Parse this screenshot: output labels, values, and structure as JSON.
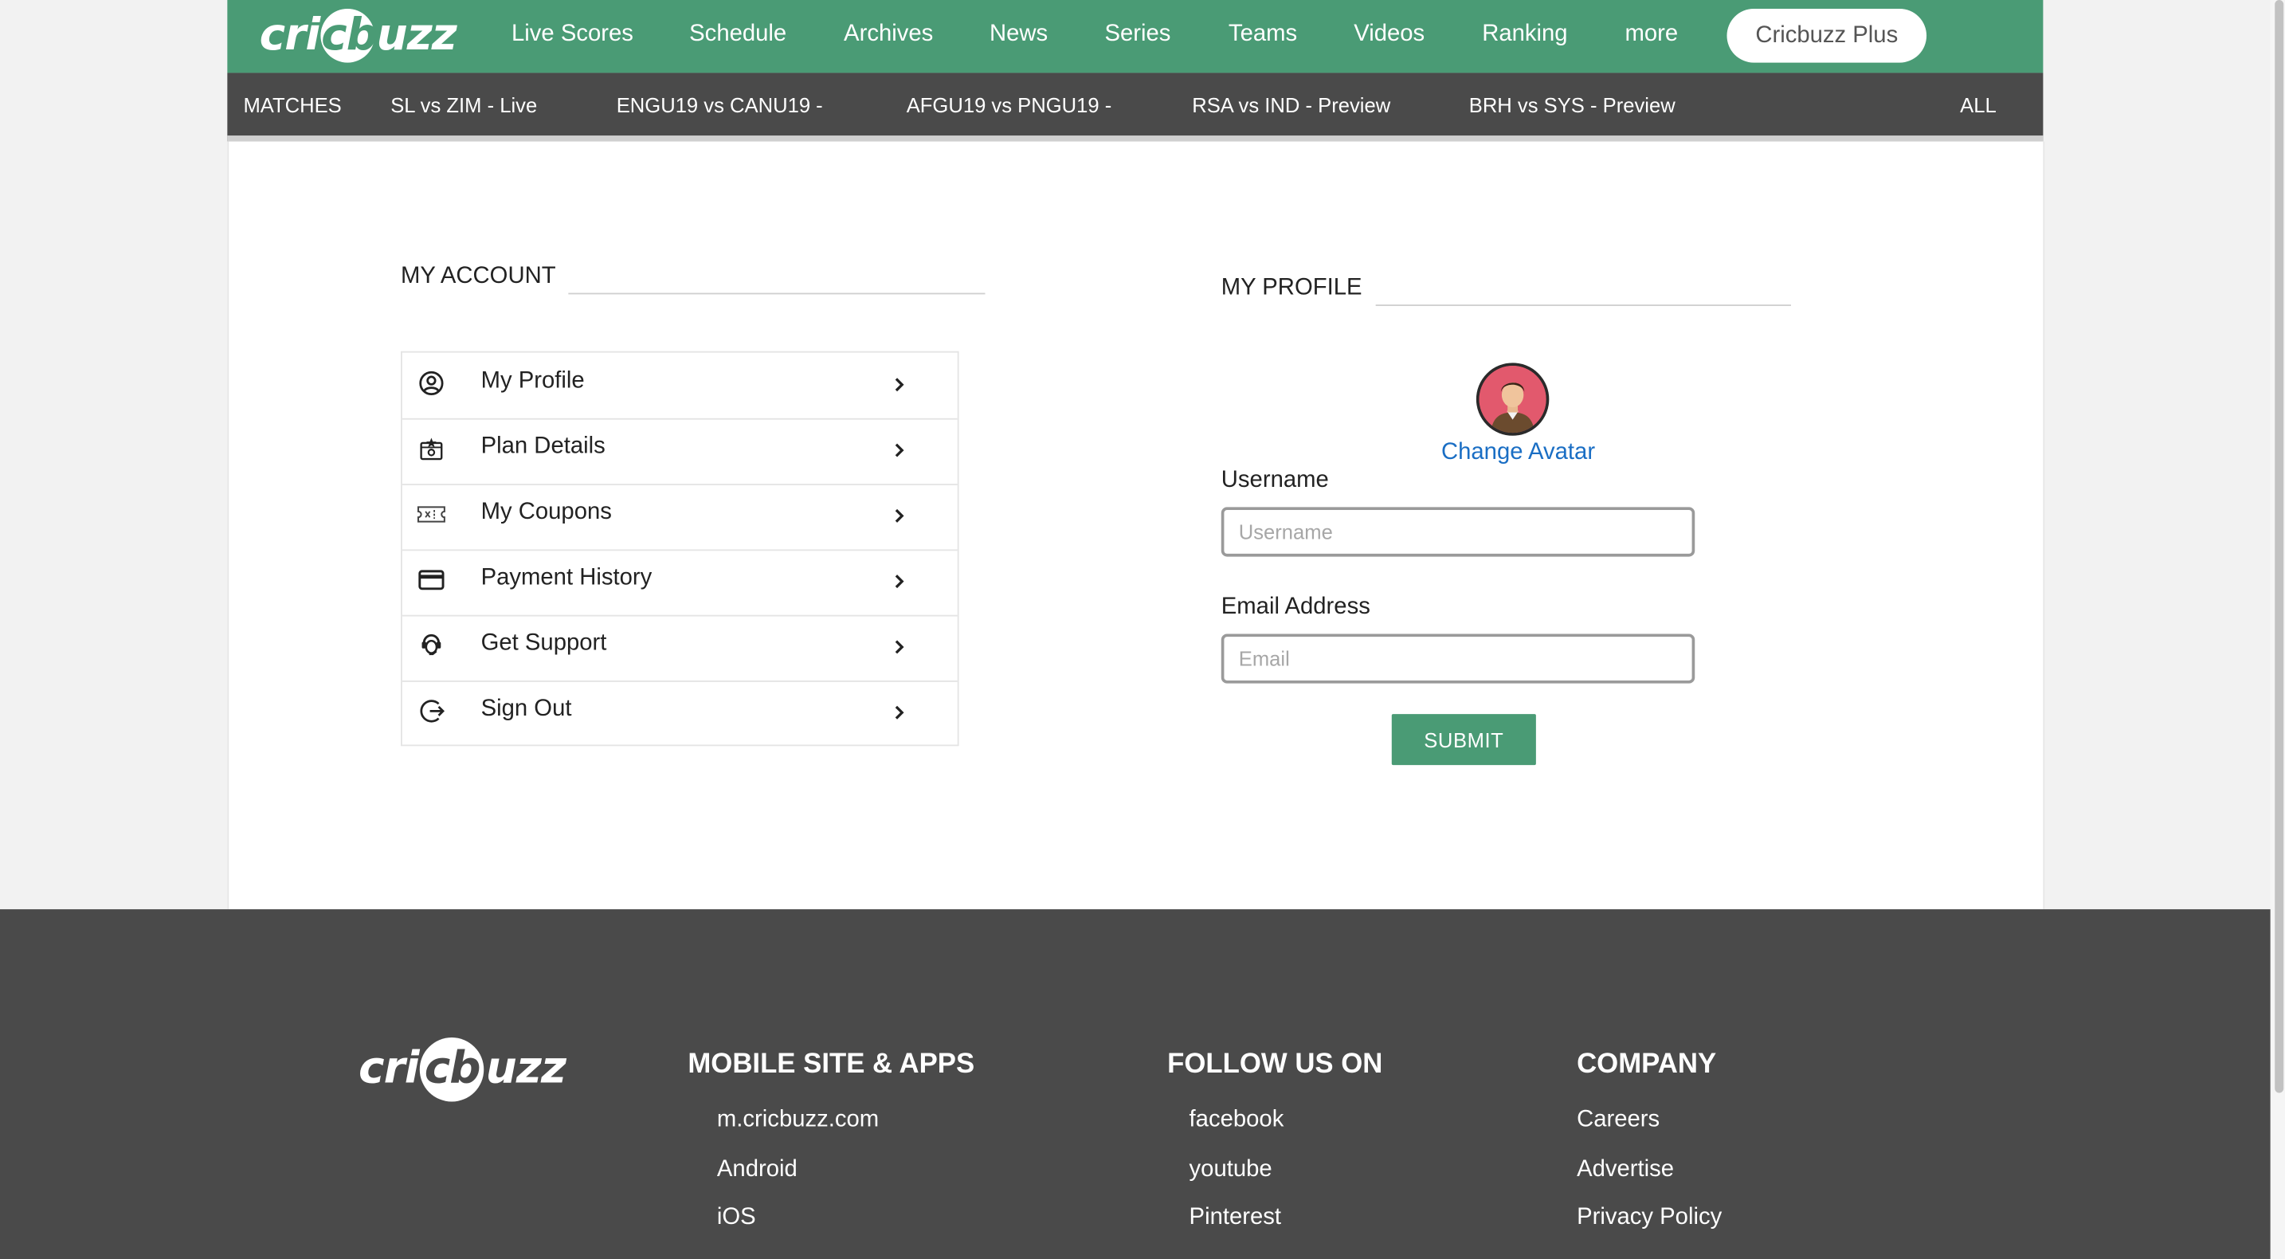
{
  "header": {
    "logo": {
      "left": "cri",
      "ball": "cb",
      "right": "uzz"
    },
    "nav": [
      {
        "label": "Live Scores"
      },
      {
        "label": "Schedule"
      },
      {
        "label": "Archives"
      },
      {
        "label": "News"
      },
      {
        "label": "Series"
      },
      {
        "label": "Teams"
      },
      {
        "label": "Videos"
      },
      {
        "label": "Ranking"
      },
      {
        "label": "more"
      }
    ],
    "plus_button": "Cricbuzz Plus",
    "brand_color": "#4a9b75"
  },
  "matches_bar": {
    "label": "MATCHES",
    "items": [
      {
        "label": "SL vs ZIM - Live"
      },
      {
        "label": "ENGU19 vs CANU19 -"
      },
      {
        "label": "AFGU19 vs PNGU19 -"
      },
      {
        "label": "RSA vs IND - Preview"
      },
      {
        "label": "BRH vs SYS - Preview"
      }
    ],
    "all_label": "ALL"
  },
  "account": {
    "title": "MY ACCOUNT",
    "menu": [
      {
        "label": "My Profile",
        "icon": "user-circle-icon"
      },
      {
        "label": "Plan Details",
        "icon": "plan-badge-icon"
      },
      {
        "label": "My Coupons",
        "icon": "coupon-ticket-icon"
      },
      {
        "label": "Payment History",
        "icon": "credit-card-icon"
      },
      {
        "label": "Get Support",
        "icon": "support-agent-icon"
      },
      {
        "label": "Sign Out",
        "icon": "sign-out-icon"
      }
    ]
  },
  "profile": {
    "title": "MY PROFILE",
    "change_avatar": "Change Avatar",
    "username": {
      "label": "Username",
      "value": "",
      "placeholder": "Username"
    },
    "email": {
      "label": "Email Address",
      "value": "",
      "placeholder": "Email"
    },
    "submit": "SUBMIT"
  },
  "footer": {
    "logo": {
      "left": "cri",
      "ball": "cb",
      "right": "uzz"
    },
    "columns": [
      {
        "heading": "MOBILE SITE & APPS",
        "links": [
          "m.cricbuzz.com",
          "Android",
          "iOS"
        ]
      },
      {
        "heading": "FOLLOW US ON",
        "links": [
          "facebook",
          "youtube",
          "Pinterest"
        ]
      },
      {
        "heading": "COMPANY",
        "links": [
          "Careers",
          "Advertise",
          "Privacy Policy"
        ]
      }
    ]
  }
}
